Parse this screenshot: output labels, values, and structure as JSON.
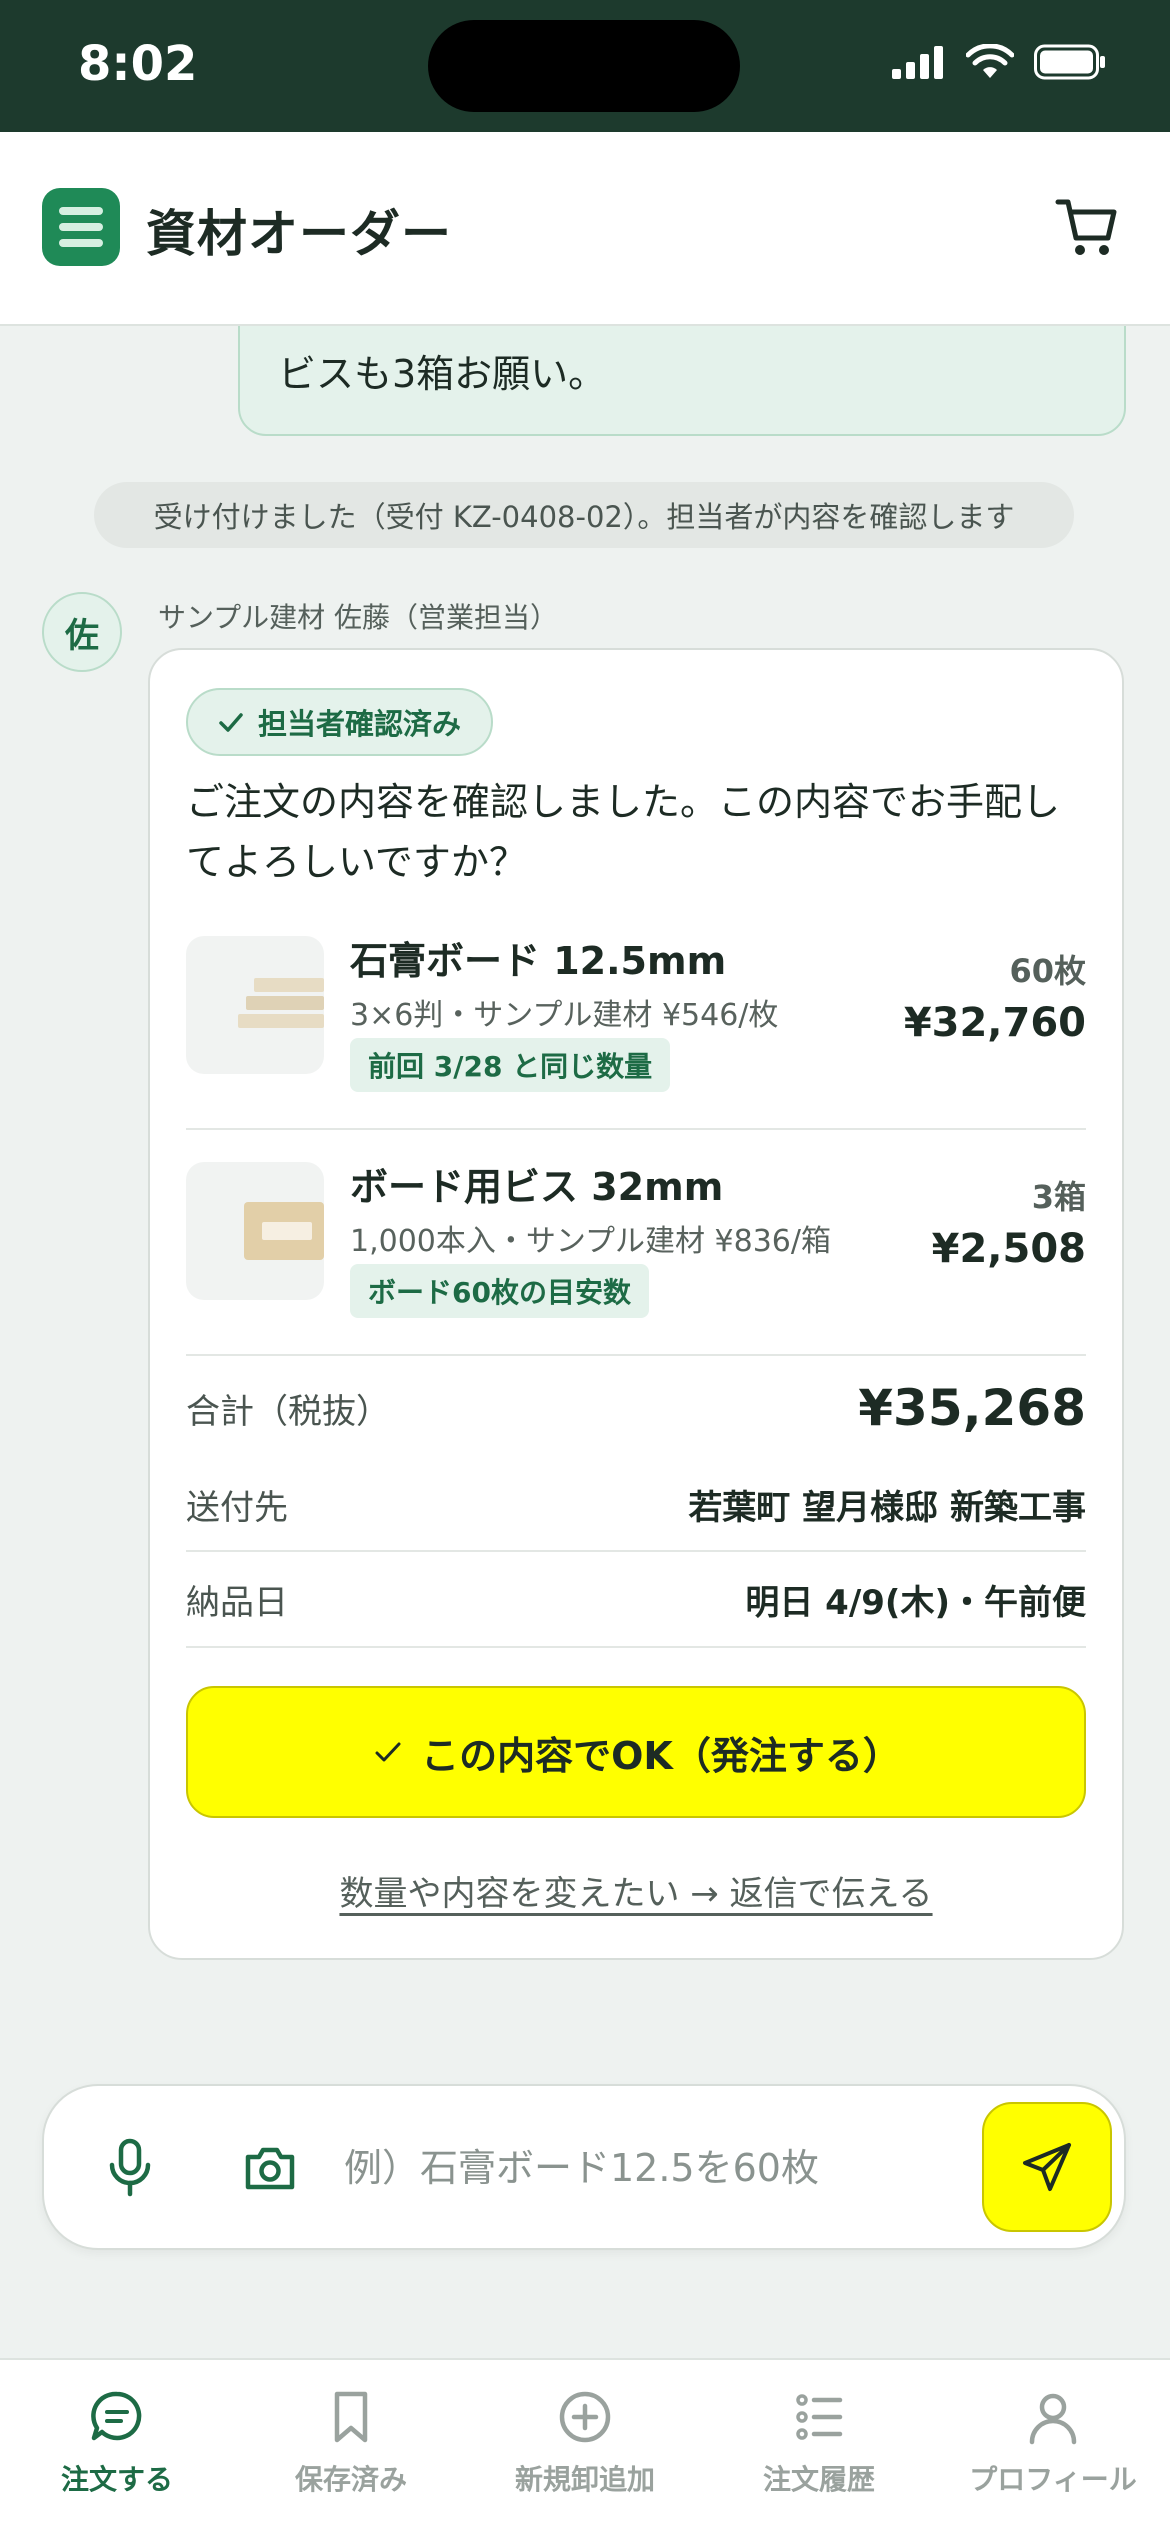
{
  "status_bar": {
    "time": "8:02"
  },
  "header": {
    "title": "資材オーダー"
  },
  "chat": {
    "previous_user_message_tail": "ビスも3箱お願い。",
    "system_note": "受け付けました（受付 KZ-0408-02）。担当者が内容を確認します",
    "sender": {
      "avatar_char": "佐",
      "name": "サンプル建材 佐藤（営業担当）"
    },
    "card": {
      "badge": "担当者確認済み",
      "message": "ご注文の内容を確認しました。この内容でお手配してよろしいですか？",
      "items": [
        {
          "name": "石膏ボード 12.5mm",
          "spec": "3×6判・サンプル建材 ¥546/枚",
          "tag": "前回 3/28 と同じ数量",
          "qty": "60枚",
          "price": "¥32,760"
        },
        {
          "name": "ボード用ビス 32mm",
          "spec": "1,000本入・サンプル建材 ¥836/箱",
          "tag": "ボード60枚の目安数",
          "qty": "3箱",
          "price": "¥2,508"
        }
      ],
      "total_label": "合計（税抜）",
      "total_value": "¥35,268",
      "destination_label": "送付先",
      "destination_value": "若葉町 望月様邸 新築工事",
      "delivery_label": "納品日",
      "delivery_value": "明日 4/9(木)・午前便",
      "ok_button": "この内容でOK（発注する）",
      "change_link": "数量や内容を変えたい → 返信で伝える"
    }
  },
  "input": {
    "placeholder": "例）石膏ボード12.5を60枚"
  },
  "nav": {
    "items": [
      {
        "label": "注文する",
        "icon": "chat-icon",
        "active": true
      },
      {
        "label": "保存済み",
        "icon": "bookmark-icon",
        "active": false
      },
      {
        "label": "新規卸追加",
        "icon": "plus-circle-icon",
        "active": false
      },
      {
        "label": "注文履歴",
        "icon": "list-icon",
        "active": false
      },
      {
        "label": "プロフィール",
        "icon": "person-icon",
        "active": false
      }
    ]
  },
  "colors": {
    "brand_green": "#1d6b45",
    "status_bar": "#1d3a2d",
    "accent_yellow": "#ffff00"
  }
}
